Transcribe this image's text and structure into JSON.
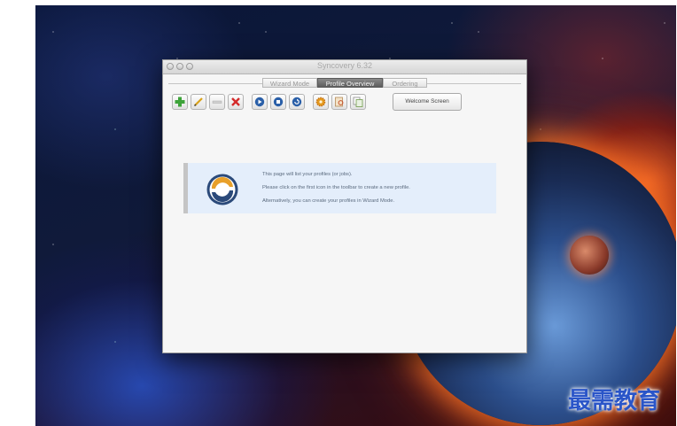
{
  "window": {
    "title": "Syncovery 6.32"
  },
  "tabs": [
    {
      "label": "Wizard Mode",
      "active": false
    },
    {
      "label": "Profile Overview",
      "active": true
    },
    {
      "label": "Ordering",
      "active": false
    }
  ],
  "toolbar": {
    "buttons": [
      {
        "icon": "plus-icon"
      },
      {
        "icon": "pencil-icon"
      },
      {
        "icon": "minus-icon"
      },
      {
        "icon": "delete-x-icon"
      },
      {
        "icon": "play-icon"
      },
      {
        "icon": "stop-icon"
      },
      {
        "icon": "refresh-icon"
      },
      {
        "icon": "gear-icon"
      },
      {
        "icon": "log-icon"
      },
      {
        "icon": "copy-icon"
      }
    ],
    "welcome_label": "Welcome Screen"
  },
  "info": {
    "line1": "This page will list your profiles (or jobs).",
    "line2": "Please click on the first icon in the toolbar to create a new profile.",
    "line3": "Alternatively, you can create your profiles in Wizard Mode."
  },
  "watermark": {
    "text": "最需教育"
  },
  "colors": {
    "active_tab": "#6e6e6e",
    "info_bg": "#e4eefb",
    "watermark": "#2a55c8"
  }
}
